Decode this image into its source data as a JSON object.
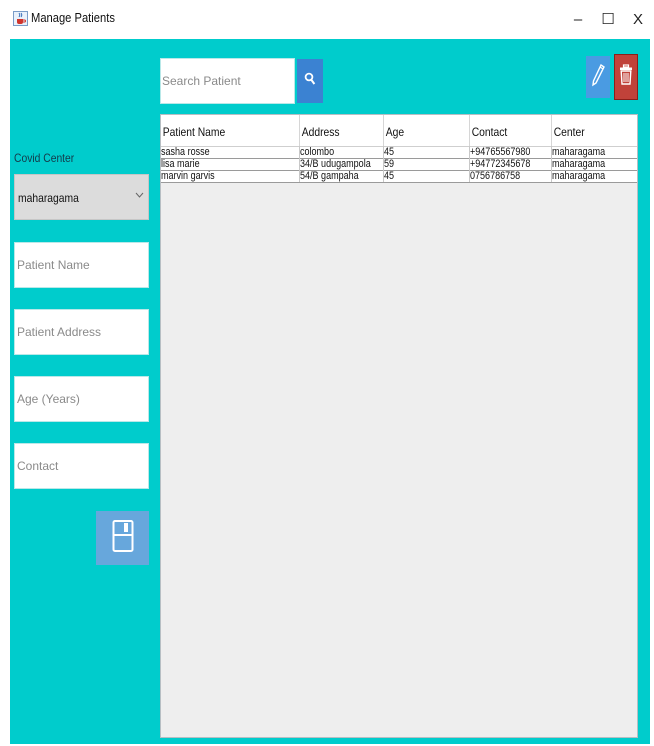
{
  "window": {
    "title": "Manage Patients",
    "icon": "java-cup-icon",
    "controls": {
      "minimize": "–",
      "maximize": "☐",
      "close": "X"
    }
  },
  "colors": {
    "background": "#00cccc",
    "search_button": "#3b82d2",
    "edit_button": "#4a9be2",
    "delete_button": "#c0423a",
    "save_button": "#67a7dc"
  },
  "toolbar": {
    "search_placeholder": "Search Patient",
    "search_icon": "search-icon",
    "edit_icon": "pencil-icon",
    "delete_icon": "trash-icon"
  },
  "form": {
    "center_label": "Covid Center",
    "center_selected": "maharagama",
    "patient_name_placeholder": "Patient Name",
    "patient_address_placeholder": "Patient Address",
    "age_placeholder": "Age (Years)",
    "contact_placeholder": "Contact",
    "save_icon": "save-icon"
  },
  "table": {
    "columns": [
      "Patient Name",
      "Address",
      "Age",
      "Contact",
      "Center"
    ],
    "rows": [
      [
        "sasha rosse",
        "colombo",
        "45",
        "+94765567980",
        "maharagama"
      ],
      [
        "lisa marie",
        "34/B udugampola",
        "59",
        "+94772345678",
        "maharagama"
      ],
      [
        "marvin garvis",
        "54/B gampaha",
        "45",
        "0756786758",
        "maharagama"
      ]
    ]
  }
}
